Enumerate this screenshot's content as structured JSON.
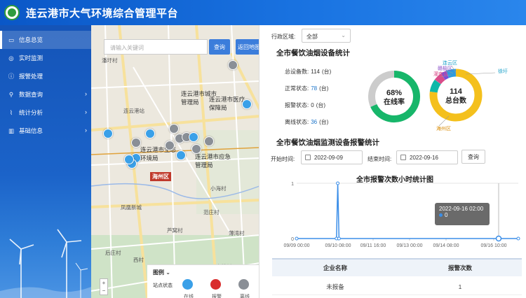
{
  "header": {
    "title": "连云港市大气环境综合管理平台"
  },
  "sidebar": {
    "items": [
      {
        "label": "信息总览",
        "icon": "monitor-icon",
        "active": true,
        "arrow": false
      },
      {
        "label": "实时监测",
        "icon": "location-icon",
        "active": false,
        "arrow": false
      },
      {
        "label": "报警处理",
        "icon": "info-icon",
        "active": false,
        "arrow": false
      },
      {
        "label": "数据查询",
        "icon": "search-icon",
        "active": false,
        "arrow": true
      },
      {
        "label": "统计分析",
        "icon": "chart-icon",
        "active": false,
        "arrow": true
      },
      {
        "label": "基础信息",
        "icon": "bar-icon",
        "active": false,
        "arrow": true
      }
    ]
  },
  "map": {
    "search_placeholder": "请输入关键词",
    "search_button": "查询",
    "back_button": "返回地图",
    "district": "海州区",
    "places": [
      "潘圩村",
      "连云港市城市管理局",
      "连云港市医疗保障局",
      "连云港站",
      "连云港市生态环境局",
      "连云港市应急管理局",
      "小海村",
      "凤凰新城",
      "范庄村",
      "薄湾村",
      "上楼村",
      "芦窝村",
      "后庄村",
      "西村"
    ],
    "legend": {
      "title": "图例",
      "label": "站点状态",
      "items": [
        "在线",
        "报警",
        "离线"
      ]
    },
    "zoom": {
      "in": "+",
      "out": "−"
    }
  },
  "panel": {
    "region_label": "行政区域:",
    "region_value": "全部",
    "stats_title": "全市餐饮油烟设备统计",
    "stats": [
      {
        "label": "总设备数:",
        "value": "114",
        "unit": "(台)"
      },
      {
        "label": "正常状态:",
        "value": "78",
        "unit": "(台)"
      },
      {
        "label": "报警状态:",
        "value": "0",
        "unit": "(台)"
      },
      {
        "label": "离线状态:",
        "value": "36",
        "unit": "(台)"
      }
    ],
    "online_donut": {
      "percent": "68%",
      "label": "在线率"
    },
    "total_donut": {
      "value": "114",
      "label": "总台数"
    },
    "alarm_title": "全市餐饮油烟监测设备报警统计",
    "start_label": "开始时间:",
    "start_date": "2022-09-09",
    "end_label": "结束时间:",
    "end_date": "2022-09-16",
    "query_button": "查询",
    "tooltip": {
      "time": "2022-09-16 02:00",
      "value": "0"
    },
    "table": {
      "headers": [
        "企业名称",
        "报警次数"
      ],
      "rows": [
        {
          "name": "未报备",
          "count": "1"
        }
      ]
    }
  },
  "colors": {
    "online": "#17b66a",
    "offline": "#cccccc",
    "alarm": "#d92c2c",
    "line": "#3b8ee8",
    "haizhou": "#f4c01c"
  },
  "chart_data": [
    {
      "type": "pie",
      "categories": [
        "在线",
        "离线"
      ],
      "values": [
        78,
        36
      ],
      "title": ""
    },
    {
      "type": "pie",
      "categories": [
        "海州区",
        "连云区",
        "赣榆区",
        "灌南县",
        "徐圩"
      ],
      "values": [
        88,
        9,
        6,
        4,
        7
      ],
      "title": ""
    },
    {
      "type": "line",
      "title": "全市报警次数小时统计图",
      "xlabel": "",
      "ylabel": "",
      "x_ticks": [
        "09/09 00:00",
        "09/10 08:00",
        "09/11 16:00",
        "09/13 00:00",
        "09/14 08:00",
        "09/16 10:00"
      ],
      "ylim": [
        0,
        1
      ],
      "y_ticks": [
        0,
        1
      ],
      "series": [
        {
          "points": [
            [
              "2022-09-09 00:00",
              0
            ],
            [
              "2022-09-10 08:00",
              0
            ],
            [
              "2022-09-10 09:00",
              1
            ],
            [
              "2022-09-10 10:00",
              0
            ],
            [
              "2022-09-16 10:00",
              0
            ]
          ]
        }
      ]
    }
  ]
}
